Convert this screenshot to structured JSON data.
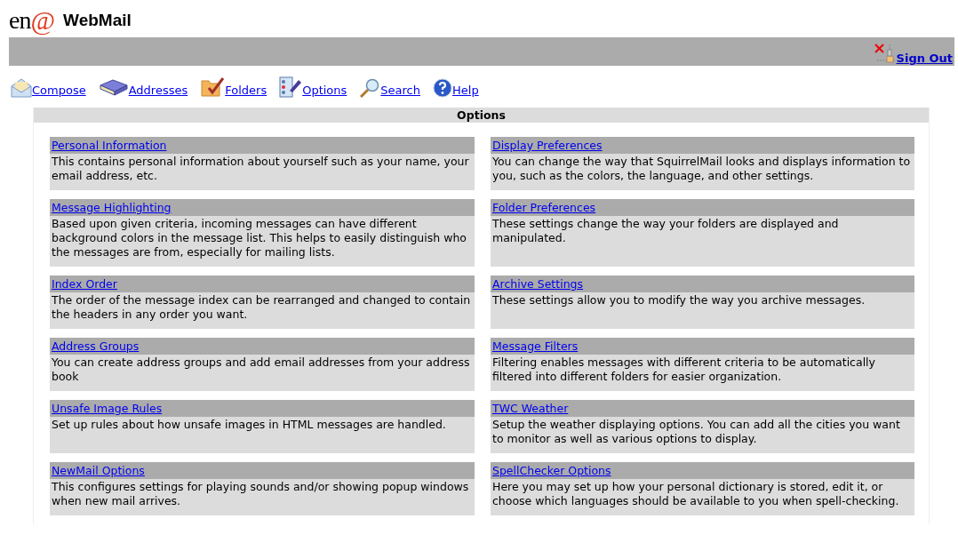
{
  "header": {
    "logo_text": "en",
    "logo_mark": "@",
    "title": "WebMail"
  },
  "top_bar": {
    "sign_out": "Sign Out"
  },
  "nav": [
    {
      "kind": "compose",
      "label": "Compose"
    },
    {
      "kind": "addresses",
      "label": "Addresses"
    },
    {
      "kind": "folders",
      "label": "Folders"
    },
    {
      "kind": "options",
      "label": "Options"
    },
    {
      "kind": "search",
      "label": "Search"
    },
    {
      "kind": "help",
      "label": "Help"
    }
  ],
  "panel": {
    "title": "Options",
    "items": [
      {
        "title": "Personal Information",
        "description": "This contains personal information about yourself such as your name, your email address, etc."
      },
      {
        "title": "Display Preferences",
        "description": "You can change the way that SquirrelMail looks and displays information to you, such as the colors, the language, and other settings."
      },
      {
        "title": "Message Highlighting",
        "description": "Based upon given criteria, incoming messages can have different background colors in the message list. This helps to easily distinguish who the messages are from, especially for mailing lists."
      },
      {
        "title": "Folder Preferences",
        "description": "These settings change the way your folders are displayed and manipulated."
      },
      {
        "title": "Index Order",
        "description": "The order of the message index can be rearranged and changed to contain the headers in any order you want."
      },
      {
        "title": "Archive Settings",
        "description": "These settings allow you to modify the way you archive messages."
      },
      {
        "title": "Address Groups",
        "description": "You can create address groups and add email addresses from your address book"
      },
      {
        "title": "Message Filters",
        "description": "Filtering enables messages with different criteria to be automatically filtered into different folders for easier organization."
      },
      {
        "title": "Unsafe Image Rules",
        "description": "Set up rules about how unsafe images in HTML messages are handled."
      },
      {
        "title": "TWC Weather",
        "description": "Setup the weather displaying options. You can add all the cities you want to monitor as well as various options to display."
      },
      {
        "title": "NewMail Options",
        "description": "This configures settings for playing sounds and/or showing popup windows when new mail arrives."
      },
      {
        "title": "SpellChecker Options",
        "description": "Here you may set up how your personal dictionary is stored, edit it, or choose which languages should be available to you when spell-checking."
      }
    ]
  }
}
